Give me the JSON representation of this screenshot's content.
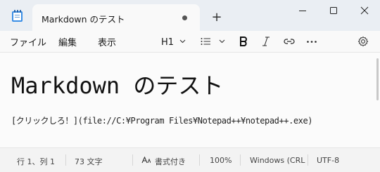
{
  "window": {
    "tab_title": "Markdown のテスト",
    "new_tab_symbol": "+"
  },
  "menu": {
    "file": "ファイル",
    "edit": "編集",
    "view": "表示"
  },
  "toolbar": {
    "heading_label": "H1"
  },
  "document": {
    "heading": "Markdown のテスト",
    "link_line": "[クリックしろ！](file://C:¥Program Files¥Notepad++¥notepad++.exe)"
  },
  "status": {
    "position": "行 1、列 1",
    "char_count": "73 文字",
    "format": "書式付き",
    "zoom": "100%",
    "line_ending": "Windows (CRL",
    "encoding": "UTF-8"
  }
}
